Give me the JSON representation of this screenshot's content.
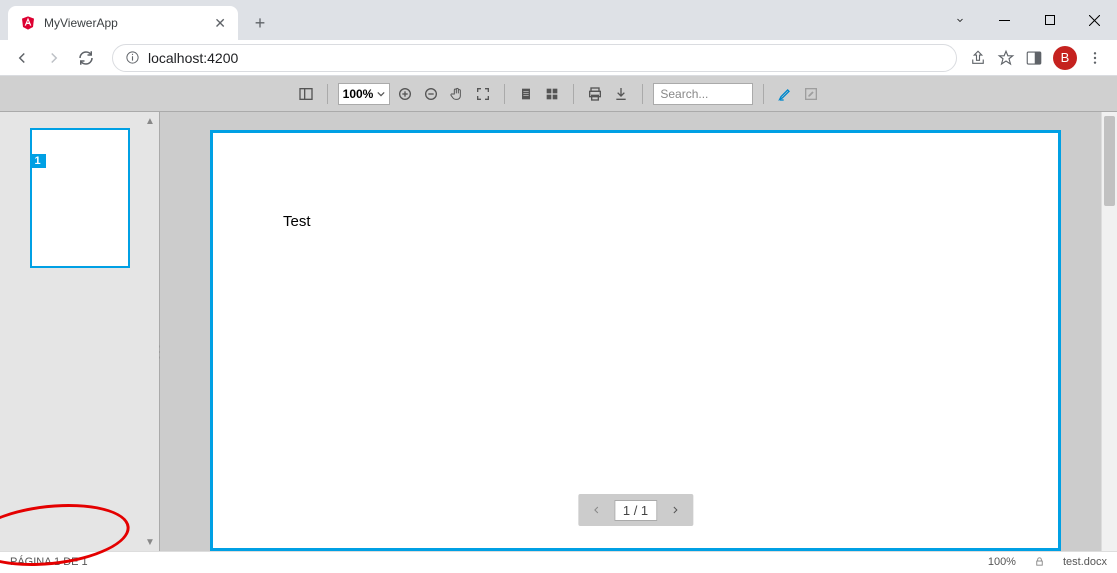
{
  "browser": {
    "tab_title": "MyViewerApp",
    "url": "localhost:4200",
    "profile_initial": "B"
  },
  "toolbar": {
    "zoom_value": "100%",
    "search_placeholder": "Search..."
  },
  "thumbnail": {
    "page_num": "1"
  },
  "document": {
    "content": "Test"
  },
  "pager": {
    "display": "1 / 1"
  },
  "status": {
    "page_text": "PÁGINA 1 DE 1",
    "zoom": "100%",
    "filename": "test.docx"
  }
}
